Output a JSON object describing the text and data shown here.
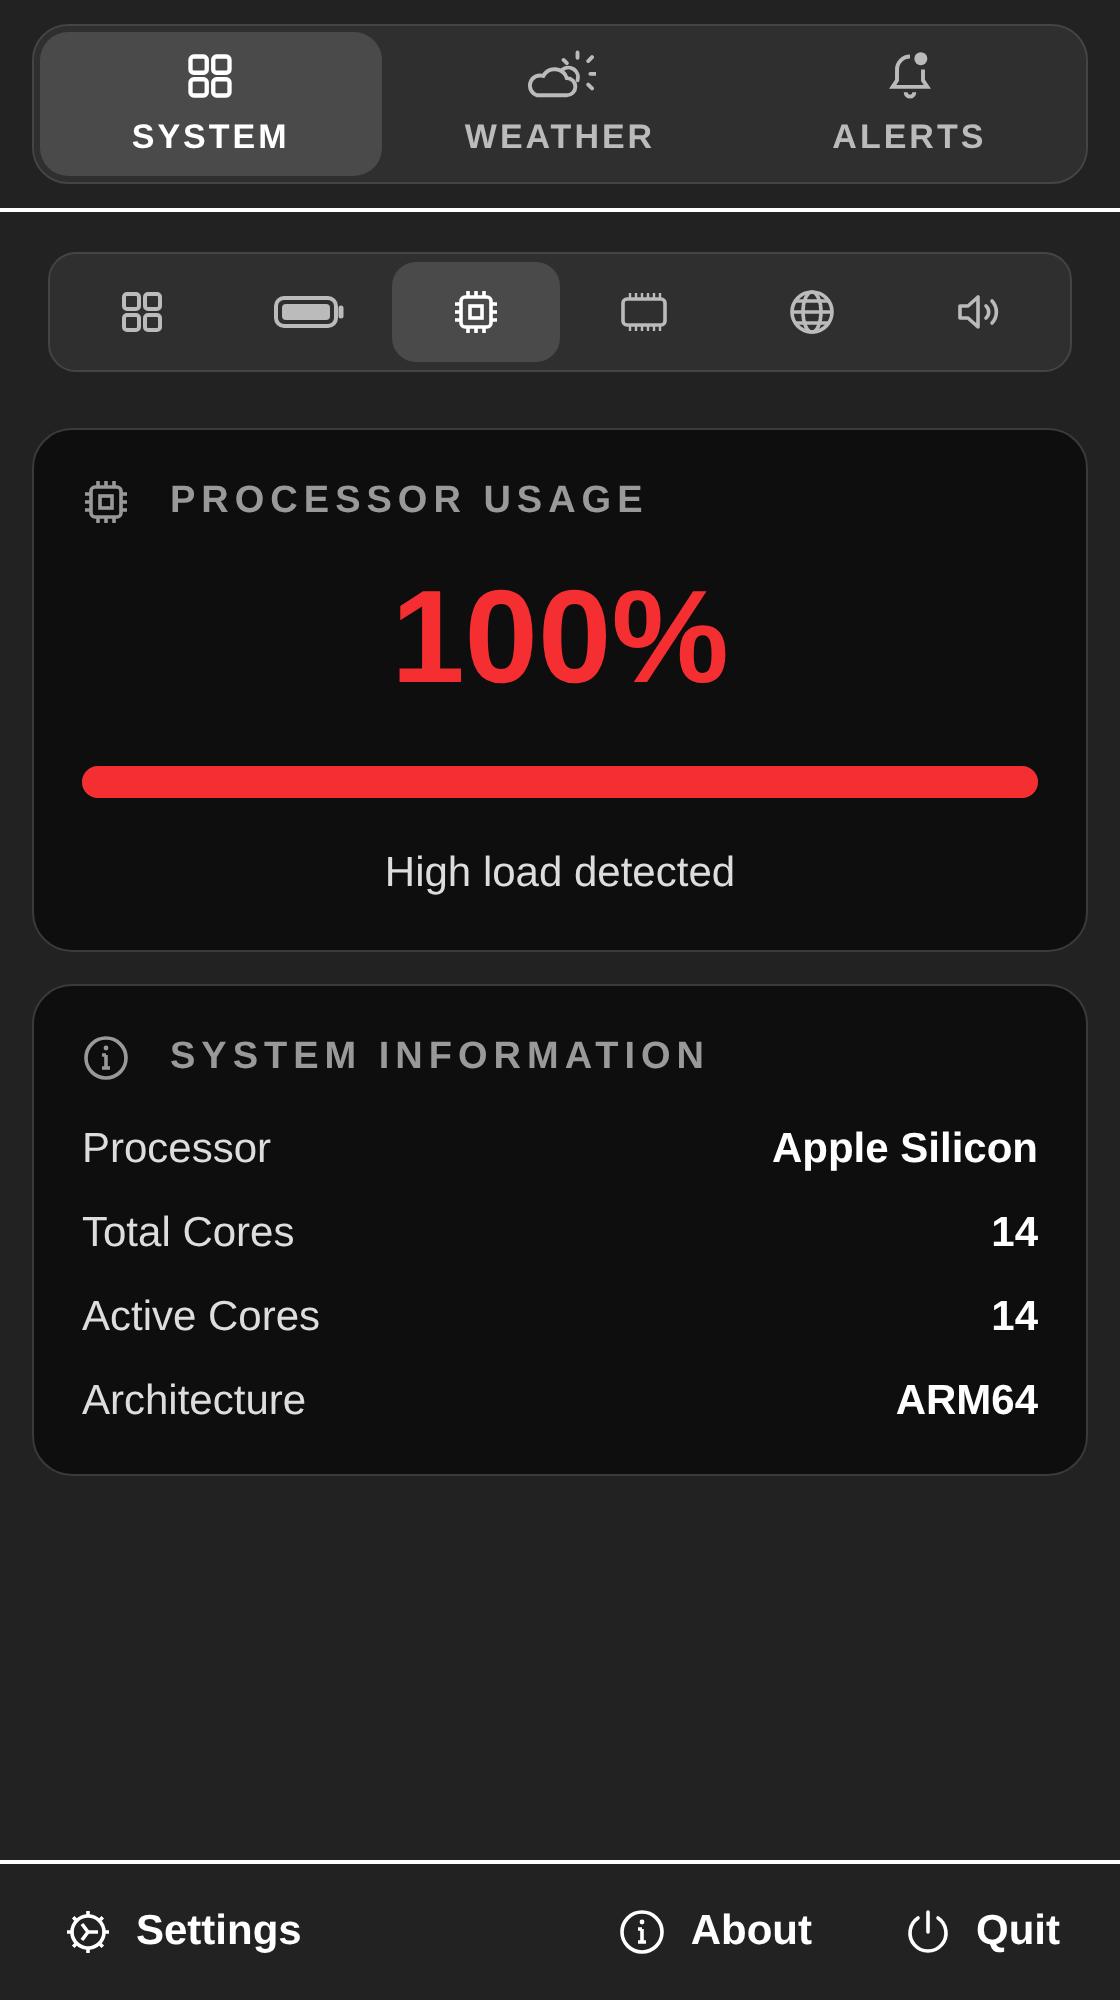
{
  "tabs": [
    {
      "label": "SYSTEM",
      "kind": "grid",
      "selected": true
    },
    {
      "label": "WEATHER",
      "kind": "weather",
      "selected": false
    },
    {
      "label": "ALERTS",
      "kind": "bell",
      "selected": false
    }
  ],
  "subtabs": [
    {
      "kind": "grid",
      "selected": false
    },
    {
      "kind": "battery",
      "selected": false
    },
    {
      "kind": "cpu",
      "selected": true
    },
    {
      "kind": "memory",
      "selected": false
    },
    {
      "kind": "globe",
      "selected": false
    },
    {
      "kind": "sound",
      "selected": false
    }
  ],
  "usage": {
    "title": "PROCESSOR USAGE",
    "value": "100%",
    "level": 1.0,
    "status": "High load detected"
  },
  "info": {
    "title": "SYSTEM INFORMATION",
    "rows": [
      {
        "label": "Processor",
        "value": "Apple Silicon"
      },
      {
        "label": "Total Cores",
        "value": "14"
      },
      {
        "label": "Active Cores",
        "value": "14"
      },
      {
        "label": "Architecture",
        "value": "ARM64"
      }
    ]
  },
  "footer": [
    {
      "label": "Settings",
      "kind": "gear"
    },
    {
      "label": "About",
      "kind": "info"
    },
    {
      "label": "Quit",
      "kind": "power"
    }
  ]
}
